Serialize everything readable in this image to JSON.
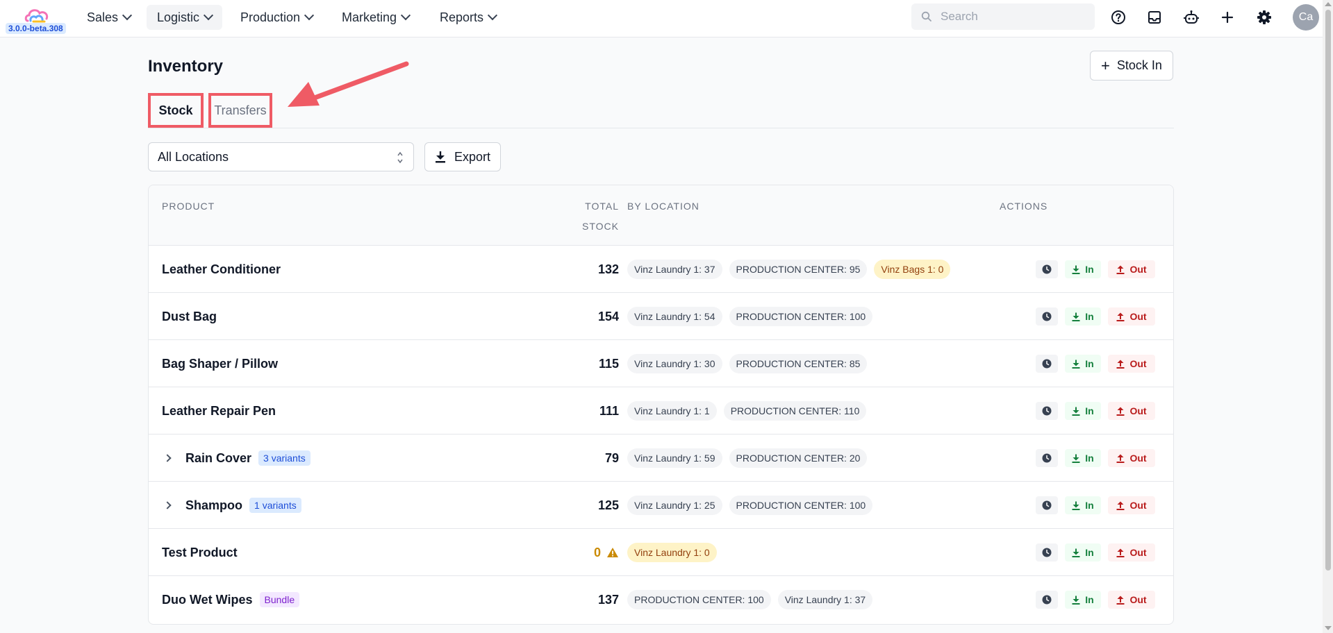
{
  "app": {
    "version": "3.0.0-beta.308"
  },
  "nav": {
    "items": [
      {
        "label": "Sales"
      },
      {
        "label": "Logistic"
      },
      {
        "label": "Production"
      },
      {
        "label": "Marketing"
      },
      {
        "label": "Reports"
      }
    ],
    "search_placeholder": "Search",
    "avatar_initials": "Ca"
  },
  "page": {
    "title": "Inventory",
    "stock_in_label": "Stock In",
    "tabs": [
      {
        "label": "Stock"
      },
      {
        "label": "Transfers"
      }
    ],
    "location_filter": "All Locations",
    "export_label": "Export"
  },
  "table": {
    "headers": {
      "product": "PRODUCT",
      "total_line1": "TOTAL",
      "total_line2": "STOCK",
      "by_location": "BY LOCATION",
      "actions": "ACTIONS"
    },
    "action_labels": {
      "in": "In",
      "out": "Out"
    },
    "rows": [
      {
        "name": "Leather Conditioner",
        "total": "132",
        "locations": [
          "Vinz Laundry 1: 37",
          "PRODUCTION CENTER: 95",
          "Vinz Bags 1: 0"
        ]
      },
      {
        "name": "Dust Bag",
        "total": "154",
        "locations": [
          "Vinz Laundry 1: 54",
          "PRODUCTION CENTER: 100"
        ]
      },
      {
        "name": "Bag Shaper / Pillow",
        "total": "115",
        "locations": [
          "Vinz Laundry 1: 30",
          "PRODUCTION CENTER: 85"
        ]
      },
      {
        "name": "Leather Repair Pen",
        "total": "111",
        "locations": [
          "Vinz Laundry 1: 1",
          "PRODUCTION CENTER: 110"
        ]
      },
      {
        "name": "Rain Cover",
        "badge": "3 variants",
        "total": "79",
        "locations": [
          "Vinz Laundry 1: 59",
          "PRODUCTION CENTER: 20"
        ]
      },
      {
        "name": "Shampoo",
        "badge": "1 variants",
        "total": "125",
        "locations": [
          "Vinz Laundry 1: 25",
          "PRODUCTION CENTER: 100"
        ]
      },
      {
        "name": "Test Product",
        "total": "0",
        "locations": [
          "Vinz Laundry 1: 0"
        ]
      },
      {
        "name": "Duo Wet Wipes",
        "badge": "Bundle",
        "total": "137",
        "locations": [
          "PRODUCTION CENTER: 100",
          "Vinz Laundry 1: 37"
        ]
      }
    ]
  },
  "colors": {
    "highlight_red": "#ef5b65",
    "in_green": "#15803d",
    "out_red": "#b91c1c",
    "warning_amber": "#ca8a04"
  }
}
